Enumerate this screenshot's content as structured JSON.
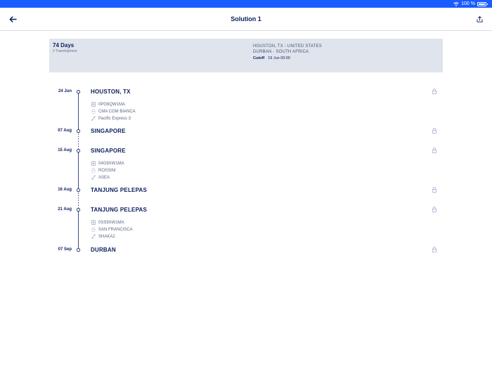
{
  "status_bar": {
    "battery": "100 %"
  },
  "nav": {
    "title": "Solution 1"
  },
  "summary": {
    "days": "74 Days",
    "transhipment": "2 Transhipment",
    "origin": "HOUSTON, TX - UNITED STATES",
    "destination": "DURBAN - SOUTH AFRICA",
    "cutoff_label": "Cutoff",
    "cutoff_value": "19 Jun 00:00"
  },
  "stops": [
    {
      "date": "24 Jun",
      "port": "HOUSTON, TX"
    },
    {
      "date": "07 Aug",
      "port": "SINGAPORE"
    },
    {
      "date": "15 Aug",
      "port": "SINGAPORE"
    },
    {
      "date": "16 Aug",
      "port": "TANJUNG PELEPAS"
    },
    {
      "date": "21 Aug",
      "port": "TANJUNG PELEPAS"
    },
    {
      "date": "07 Sep",
      "port": "DURBAN"
    }
  ],
  "legs": [
    {
      "voyage": "0PG9QW1MA",
      "vessel": "CMA CGM BIANCA",
      "service": "Pacific Express 3"
    },
    {
      "voyage": "04G9XW1MA",
      "vessel": "ROSSINI",
      "service": "ASEA"
    },
    {
      "voyage": "0SS9XW1MA",
      "vessel": "SAN FRANCISCA",
      "service": "SHAKA2"
    }
  ],
  "icons": {
    "back": "arrow-left-icon",
    "share": "share-icon",
    "lock": "lock-icon",
    "voyage": "document-icon",
    "vessel": "ship-icon",
    "service": "route-icon"
  },
  "colors": {
    "accent": "#1b5cff",
    "navy": "#0b1f5c",
    "summary_bg": "#dfe4ed",
    "muted": "#5a6585"
  }
}
